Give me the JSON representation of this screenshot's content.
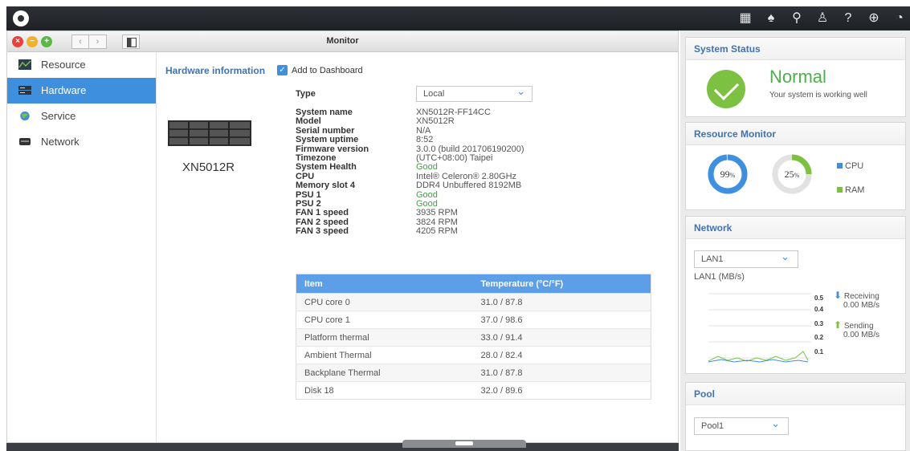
{
  "window": {
    "title": "Monitor"
  },
  "sidebar": {
    "items": [
      {
        "label": "Resource"
      },
      {
        "label": "Hardware"
      },
      {
        "label": "Service"
      },
      {
        "label": "Network"
      }
    ]
  },
  "hardware": {
    "section_title": "Hardware information",
    "add_dashboard": "Add to Dashboard",
    "device_name": "XN5012R",
    "type_label": "Type",
    "type_value": "Local",
    "specs": [
      {
        "label": "System name",
        "value": "XN5012R-FF14CC"
      },
      {
        "label": "Model",
        "value": "XN5012R"
      },
      {
        "label": "Serial number",
        "value": "N/A"
      },
      {
        "label": "System uptime",
        "value": "8:52"
      },
      {
        "label": "Firmware version",
        "value": "3.0.0 (build 201706190200)"
      },
      {
        "label": "Timezone",
        "value": "(UTC+08:00) Taipei"
      },
      {
        "label": "System Health",
        "value": "Good"
      },
      {
        "label": "CPU",
        "value": "Intel® Celeron® 2.80GHz"
      },
      {
        "label": "Memory slot 4",
        "value": "DDR4 Unbuffered 8192MB"
      },
      {
        "label": "PSU 1",
        "value": "Good"
      },
      {
        "label": "PSU 2",
        "value": "Good"
      },
      {
        "label": "FAN 1 speed",
        "value": "3935 RPM"
      },
      {
        "label": "FAN 2 speed",
        "value": "3824 RPM"
      },
      {
        "label": "FAN 3 speed",
        "value": "4205 RPM"
      }
    ],
    "temp_table": {
      "headers": [
        "Item",
        "Temperature (°C/°F)"
      ],
      "rows": [
        [
          "CPU core 0",
          "31.0 / 87.8"
        ],
        [
          "CPU core 1",
          "37.0 / 98.6"
        ],
        [
          "Platform thermal",
          "33.0 / 91.4"
        ],
        [
          "Ambient Thermal",
          "28.0 / 82.4"
        ],
        [
          "Backplane Thermal",
          "31.0 / 87.8"
        ],
        [
          "Disk 18",
          "32.0 / 89.6"
        ]
      ]
    }
  },
  "panel": {
    "system_status": {
      "title": "System Status",
      "state": "Normal",
      "message": "Your system is working well"
    },
    "resource_monitor": {
      "title": "Resource Monitor",
      "cpu_value": "99",
      "ram_value": "25",
      "unit": "%",
      "cpu_fraction": 0.99,
      "ram_fraction": 0.25,
      "cpu_label": "CPU",
      "ram_label": "RAM",
      "cpu_color": "#3f8fdf",
      "ram_color": "#7cc142"
    },
    "network": {
      "title": "Network",
      "interface": "LAN1",
      "chart_label": "LAN1 (MB/s)",
      "y_ticks": [
        "0.5",
        "0.4",
        "0.3",
        "0.2",
        "0.1"
      ],
      "receiving_label": "Receiving",
      "receiving_value": "0.00 MB/s",
      "sending_label": "Sending",
      "sending_value": "0.00 MB/s"
    },
    "pool": {
      "title": "Pool",
      "value": "Pool1"
    }
  }
}
